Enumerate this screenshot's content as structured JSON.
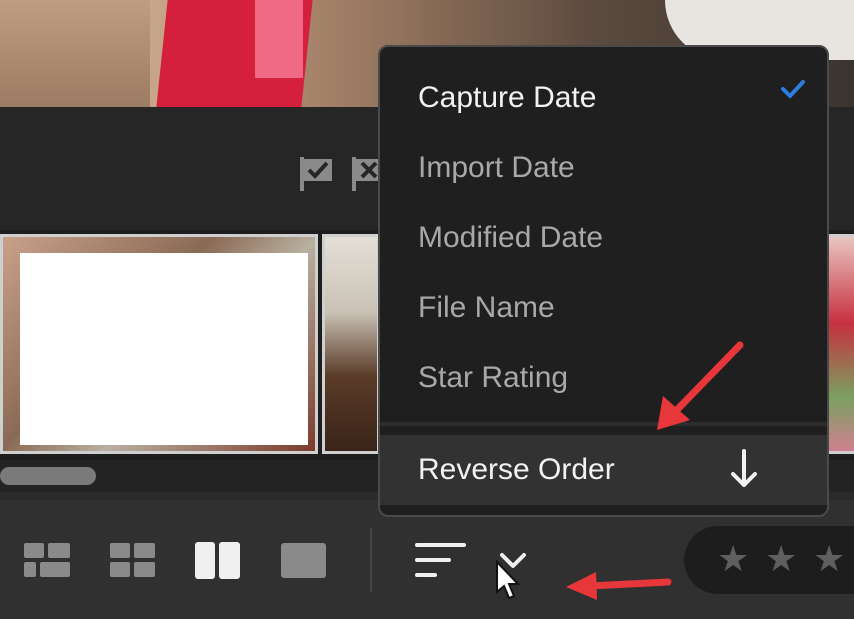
{
  "sort_menu": {
    "items": [
      {
        "label": "Capture Date",
        "selected": true
      },
      {
        "label": "Import Date",
        "selected": false
      },
      {
        "label": "Modified Date",
        "selected": false
      },
      {
        "label": "File Name",
        "selected": false
      },
      {
        "label": "Star Rating",
        "selected": false
      }
    ],
    "reverse_order_label": "Reverse Order",
    "checkmark_icon": "checkmark-icon",
    "reverse_icon": "arrow-down-icon"
  },
  "toolbar": {
    "view_icons": [
      "square-grid-view-icon",
      "grid-view-icon",
      "compare-view-icon",
      "detail-view-icon"
    ],
    "sort_icon": "sort-lines-icon",
    "sort_dropdown_icon": "chevron-down-icon",
    "rating_stars": 3
  },
  "flags": [
    "pick-flag-icon",
    "reject-flag-icon"
  ],
  "colors": {
    "accent": "#2b7de0",
    "annotation": "#e8373a",
    "menu_bg": "#1f1f1f"
  }
}
